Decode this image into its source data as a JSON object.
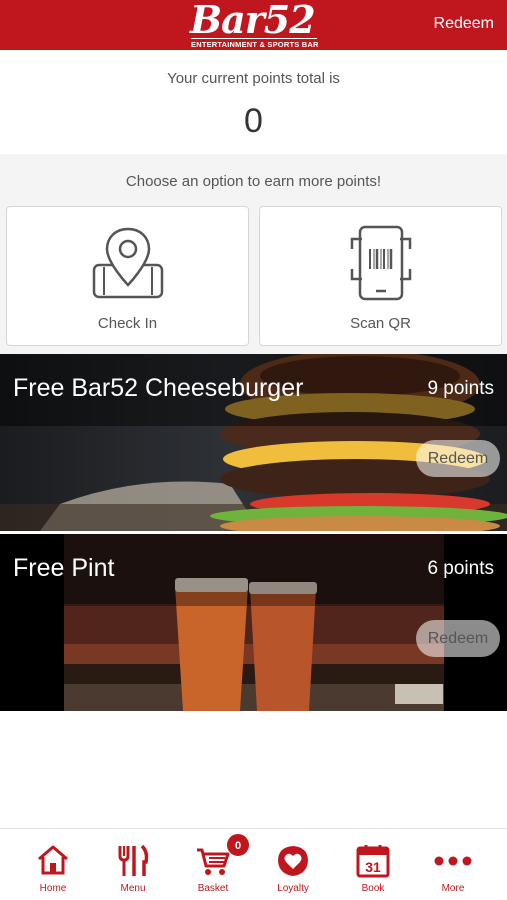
{
  "header": {
    "logo_text": "Bar52",
    "logo_tagline": "ENTERTAINMENT & SPORTS BAR",
    "redeem_label": "Redeem",
    "brand_color": "#c0171f"
  },
  "points": {
    "label": "Your current points total is",
    "value": "0"
  },
  "earn": {
    "label": "Choose an option to earn more points!",
    "options": [
      {
        "label": "Check In",
        "icon": "location-phone-icon"
      },
      {
        "label": "Scan QR",
        "icon": "qr-scan-phone-icon"
      }
    ]
  },
  "rewards": [
    {
      "title": "Free Bar52 Cheeseburger",
      "points": "9 points",
      "button": "Redeem",
      "image": "cheeseburger-photo"
    },
    {
      "title": "Free Pint",
      "points": "6 points",
      "button": "Redeem",
      "image": "beer-pints-photo"
    }
  ],
  "bottom_nav": {
    "basket_count": "0",
    "items": [
      {
        "label": "Home",
        "icon": "home-icon"
      },
      {
        "label": "Menu",
        "icon": "cutlery-icon"
      },
      {
        "label": "Basket",
        "icon": "cart-icon"
      },
      {
        "label": "Loyalty",
        "icon": "heart-icon"
      },
      {
        "label": "Book",
        "icon": "calendar-icon"
      },
      {
        "label": "More",
        "icon": "more-dots-icon"
      }
    ]
  }
}
